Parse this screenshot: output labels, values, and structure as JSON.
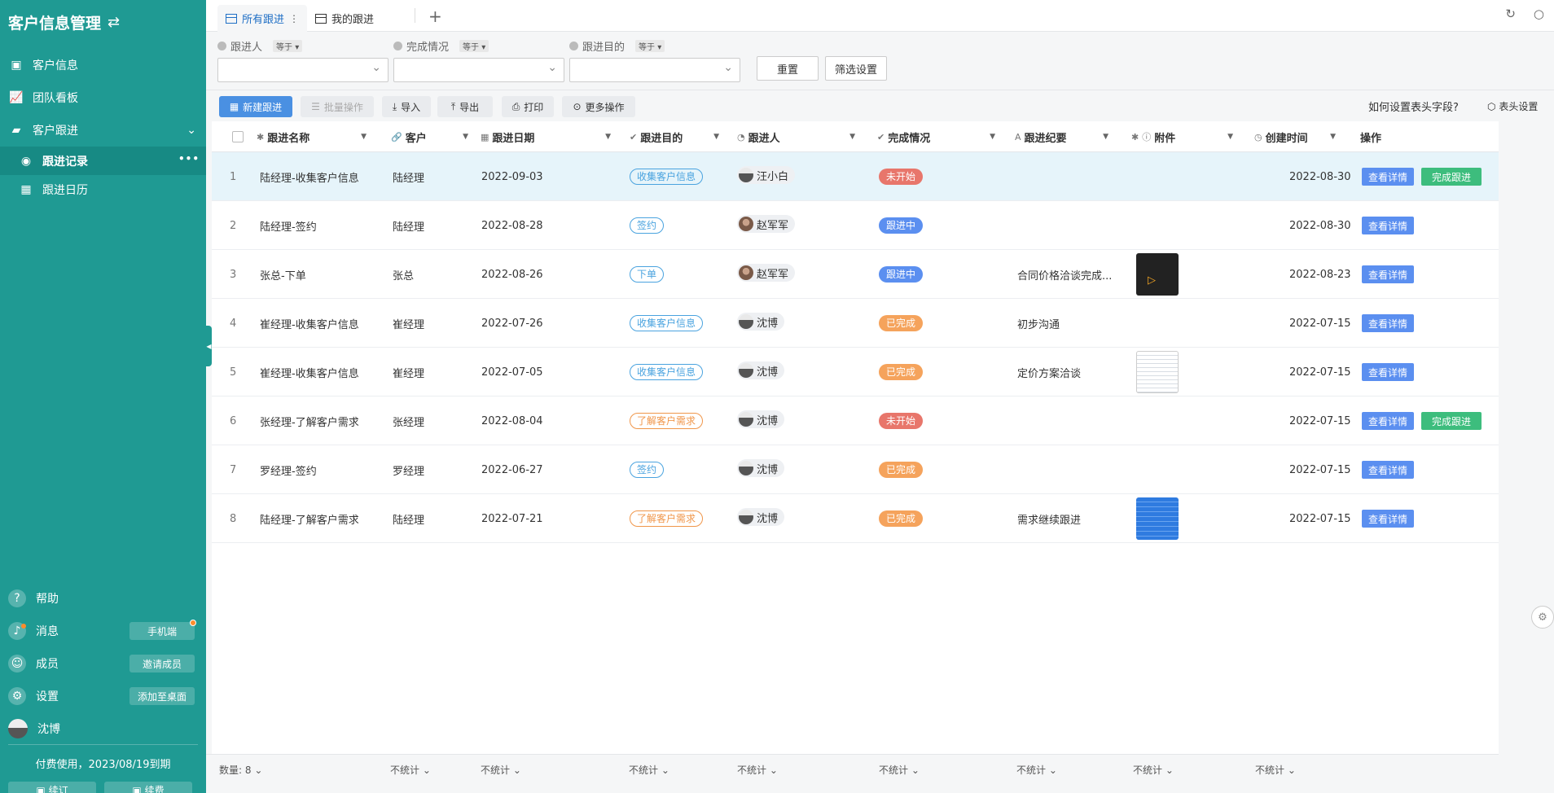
{
  "sidebar": {
    "title": "客户信息管理",
    "items": [
      {
        "label": "客户信息"
      },
      {
        "label": "团队看板"
      },
      {
        "label": "客户跟进"
      },
      {
        "label": "跟进记录"
      },
      {
        "label": "跟进日历"
      }
    ],
    "bottom": {
      "help": "帮助",
      "messages": "消息",
      "mobile_btn": "手机端",
      "members": "成员",
      "invite_btn": "邀请成员",
      "settings": "设置",
      "desktop_btn": "添加至桌面",
      "user": "沈博"
    },
    "paid_text": "付费使用，2023/08/19到期",
    "footer_btn1": "▣ 续订",
    "footer_btn2": "▣ 续费"
  },
  "tabs": [
    {
      "label": "所有跟进"
    },
    {
      "label": "我的跟进"
    }
  ],
  "filters": [
    {
      "label": "跟进人",
      "op": "等于"
    },
    {
      "label": "完成情况",
      "op": "等于"
    },
    {
      "label": "跟进目的",
      "op": "等于"
    }
  ],
  "filter_buttons": {
    "reset": "重置",
    "settings": "筛选设置"
  },
  "toolbar": {
    "new": "新建跟进",
    "batch": "批量操作",
    "import": "导入",
    "export": "导出",
    "print": "打印",
    "more": "更多操作",
    "help": "如何设置表头字段?",
    "header_settings": "表头设置"
  },
  "columns": [
    "跟进名称",
    "客户",
    "跟进日期",
    "跟进目的",
    "跟进人",
    "完成情况",
    "跟进纪要",
    "附件",
    "创建时间",
    "操作"
  ],
  "rows": [
    {
      "idx": "1",
      "name": "陆经理-收集客户信息",
      "customer": "陆经理",
      "date": "2022-09-03",
      "purpose": "收集客户信息",
      "person": "汪小白",
      "status": "未开始",
      "notes": "",
      "created": "2022-08-30",
      "detail": "查看详情",
      "done": "完成跟进"
    },
    {
      "idx": "2",
      "name": "陆经理-签约",
      "customer": "陆经理",
      "date": "2022-08-28",
      "purpose": "签约",
      "person": "赵军军",
      "status": "跟进中",
      "notes": "",
      "created": "2022-08-30",
      "detail": "查看详情",
      "done": ""
    },
    {
      "idx": "3",
      "name": "张总-下单",
      "customer": "张总",
      "date": "2022-08-26",
      "purpose": "下单",
      "person": "赵军军",
      "status": "跟进中",
      "notes": "合同价格洽谈完成...",
      "created": "2022-08-23",
      "detail": "查看详情",
      "done": ""
    },
    {
      "idx": "4",
      "name": "崔经理-收集客户信息",
      "customer": "崔经理",
      "date": "2022-07-26",
      "purpose": "收集客户信息",
      "person": "沈博",
      "status": "已完成",
      "notes": "初步沟通",
      "created": "2022-07-15",
      "detail": "查看详情",
      "done": ""
    },
    {
      "idx": "5",
      "name": "崔经理-收集客户信息",
      "customer": "崔经理",
      "date": "2022-07-05",
      "purpose": "收集客户信息",
      "person": "沈博",
      "status": "已完成",
      "notes": "定价方案洽谈",
      "created": "2022-07-15",
      "detail": "查看详情",
      "done": ""
    },
    {
      "idx": "6",
      "name": "张经理-了解客户需求",
      "customer": "张经理",
      "date": "2022-08-04",
      "purpose": "了解客户需求",
      "person": "沈博",
      "status": "未开始",
      "notes": "",
      "created": "2022-07-15",
      "detail": "查看详情",
      "done": "完成跟进"
    },
    {
      "idx": "7",
      "name": "罗经理-签约",
      "customer": "罗经理",
      "date": "2022-06-27",
      "purpose": "签约",
      "person": "沈博",
      "status": "已完成",
      "notes": "",
      "created": "2022-07-15",
      "detail": "查看详情",
      "done": ""
    },
    {
      "idx": "8",
      "name": "陆经理-了解客户需求",
      "customer": "陆经理",
      "date": "2022-07-21",
      "purpose": "了解客户需求",
      "person": "沈博",
      "status": "已完成",
      "notes": "需求继续跟进",
      "created": "2022-07-15",
      "detail": "查看详情",
      "done": ""
    }
  ],
  "summary": {
    "count_label": "数量: 8",
    "none": "不统计"
  },
  "colors": {
    "sidebar": "#1f9a93",
    "primary": "#4a90e2",
    "todo": "#e8766b",
    "doing": "#5b8ff0",
    "done_status": "#f5a35c",
    "done_btn": "#3dbd7d"
  }
}
